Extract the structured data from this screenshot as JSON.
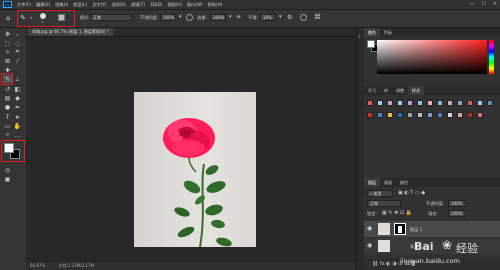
{
  "menu": {
    "logo": "Ps",
    "items": [
      "文件(F)",
      "编辑(E)",
      "图像(I)",
      "图层(L)",
      "文字(Y)",
      "选择(S)",
      "滤镜(T)",
      "3D(D)",
      "视图(V)",
      "窗口(W)",
      "帮助(H)"
    ]
  },
  "window_controls": {
    "min": "—",
    "max": "☐",
    "close": "✕"
  },
  "options": {
    "brush_size": "1",
    "mode_label": "模式:",
    "mode_value": "正常",
    "opacity_label": "不透明度:",
    "opacity_value": "100%",
    "flow_label": "流量:",
    "flow_value": "100%",
    "smooth_label": "平滑:",
    "smooth_value": "10%"
  },
  "document_tab": {
    "title": "玫瑰.jpg @ 66.7% (图层 1, 图层蒙版/8) *"
  },
  "status": {
    "zoom": "66.67%",
    "doc_info": "文档:2.17M/2.17M"
  },
  "color_panel": {
    "tabs": [
      "颜色",
      "色板"
    ],
    "active": "颜色"
  },
  "swatch_panel": {
    "tabs": [
      "学习",
      "库",
      "调整",
      "样式"
    ],
    "active": "样式",
    "row1": [
      "#e85b5b",
      "#9ec9e8",
      "#c6a0d6",
      "#9fcfe6",
      "#c0a0c8",
      "#8ec8e0",
      "#f0b0b0",
      "#7fc0e0",
      "#b8b8b8",
      "#88a8d0",
      "#d06060",
      "#a0c8f0",
      "#6090c8"
    ],
    "row2": [
      "#c83030",
      "#4d86c4",
      "#f0c040",
      "#2e6ab0",
      "#a0a0a0",
      "#c0c0c0",
      "#7aa0d0",
      "#5080c0",
      "#d8d8d8",
      "#e0a0a0",
      "#b03030",
      "#d87070"
    ]
  },
  "layers_panel": {
    "tabs": [
      "图层",
      "通道",
      "路径"
    ],
    "active": "图层",
    "filter_label": "类型",
    "blend_mode": "正常",
    "opacity_label": "不透明度:",
    "opacity_value": "100%",
    "lock_label": "锁定:",
    "fill_label": "填充:",
    "fill_value": "100%",
    "layers": [
      "图层 1",
      "背景"
    ]
  },
  "watermark": {
    "text": "jingyan.baidu.com",
    "brand": "Bai",
    "brand2": "经验"
  },
  "colors": {
    "foreground": "#ffffff",
    "background": "#000000",
    "highlight": "#e02020",
    "picker_hue": "#ff2020"
  }
}
